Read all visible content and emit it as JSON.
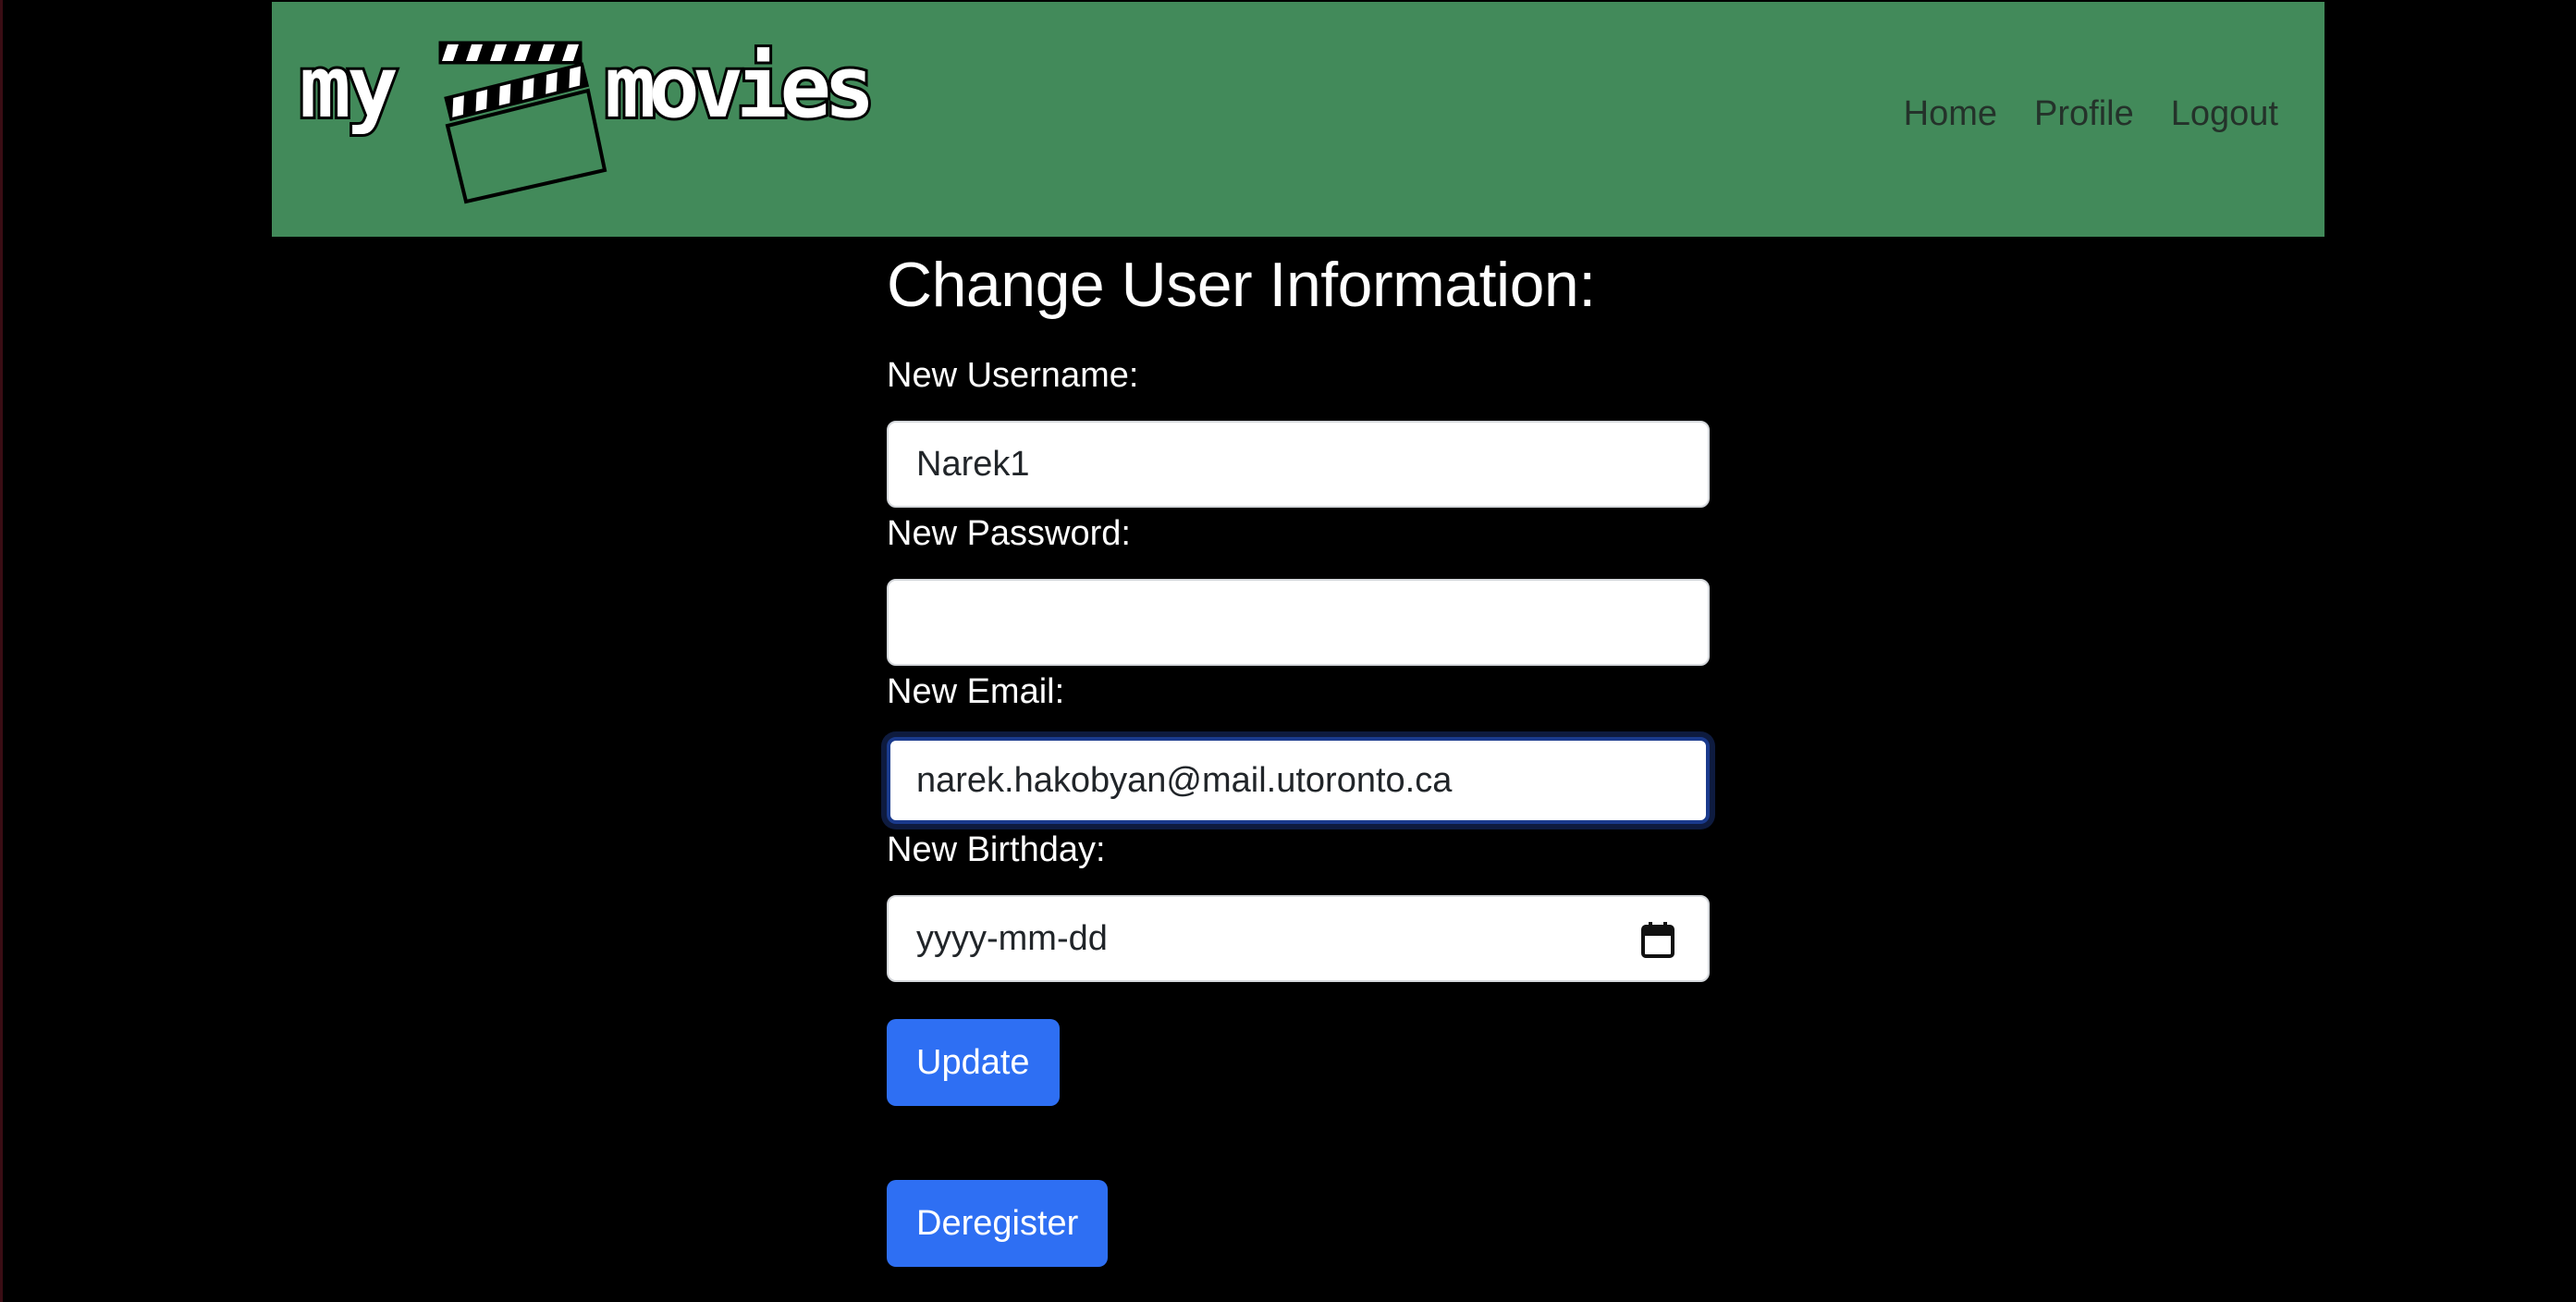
{
  "header": {
    "logo_text_left": "my",
    "logo_text_right": "movies",
    "bg_color": "#428a5a",
    "nav": [
      {
        "label": "Home"
      },
      {
        "label": "Profile"
      },
      {
        "label": "Logout"
      }
    ]
  },
  "form": {
    "title": "Change User Information:",
    "username": {
      "label": "New Username:",
      "value": "Narek1"
    },
    "password": {
      "label": "New Password:",
      "value": ""
    },
    "email": {
      "label": "New Email:",
      "value": "narek.hakobyan@mail.utoronto.ca"
    },
    "birthday": {
      "label": "New Birthday:",
      "placeholder": "yyyy-mm-dd",
      "icon": "calendar-icon"
    },
    "update_label": "Update",
    "deregister_label": "Deregister",
    "button_color": "#2e6ff3"
  }
}
